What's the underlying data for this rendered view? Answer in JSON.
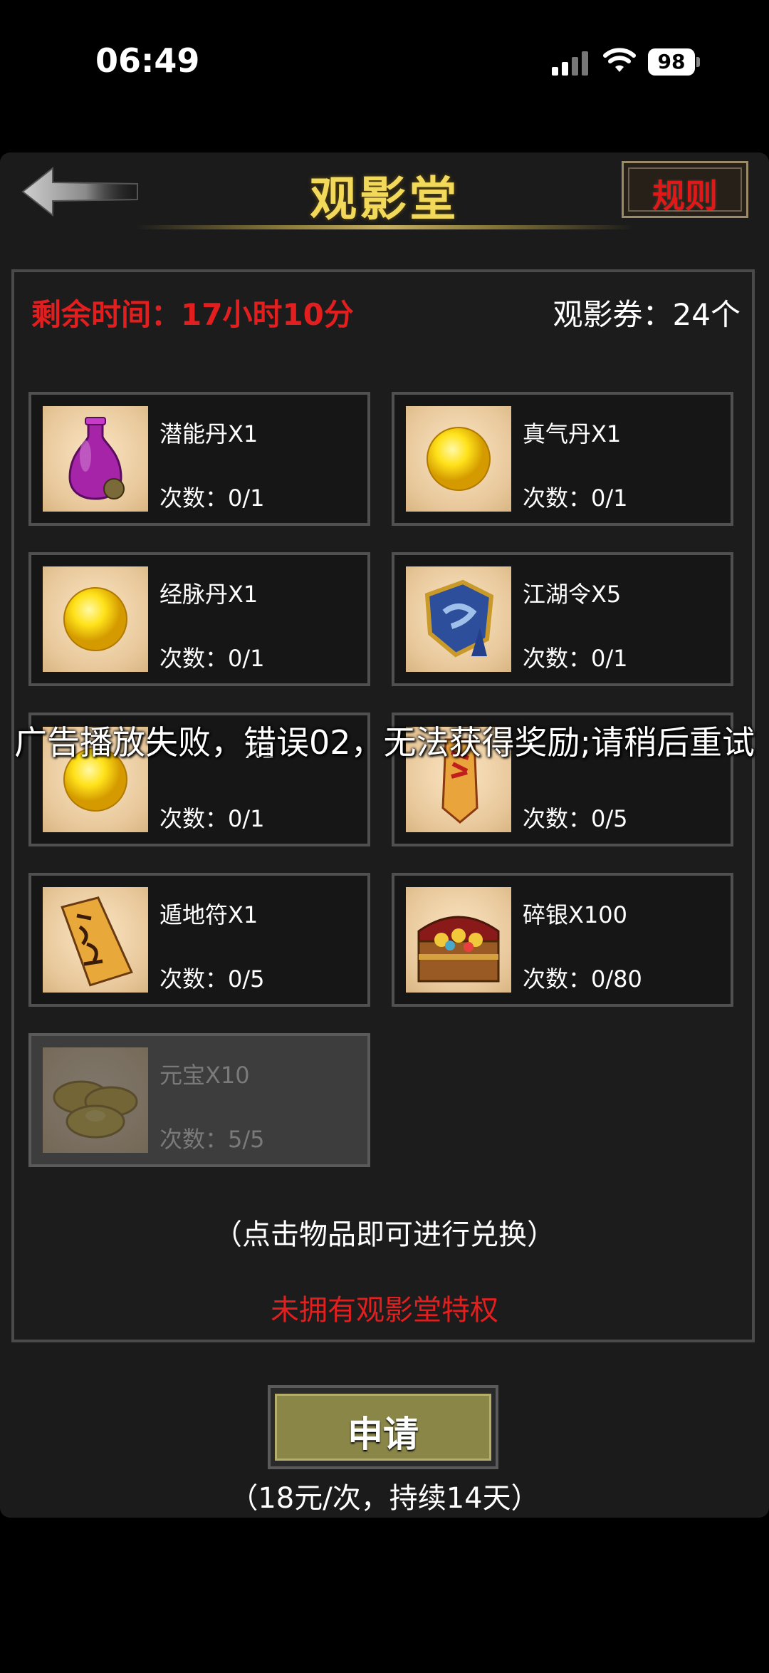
{
  "status_bar": {
    "time": "06:49",
    "battery": "98"
  },
  "header": {
    "title": "观影堂",
    "rules_label": "规则"
  },
  "summary": {
    "remaining_time": "剩余时间：17小时10分",
    "tickets": "观影券：24个"
  },
  "items": [
    {
      "name": "潜能丹X1",
      "count": "次数：0/1",
      "icon": "purple-vase-icon"
    },
    {
      "name": "真气丹X1",
      "count": "次数：0/1",
      "icon": "gold-pill-icon"
    },
    {
      "name": "经脉丹X1",
      "count": "次数：0/1",
      "icon": "gold-pill-icon"
    },
    {
      "name": "江湖令X5",
      "count": "次数：0/1",
      "icon": "jianghu-token-icon"
    },
    {
      "name": "X1",
      "count": "次数：0/1",
      "icon": "gold-pill-icon"
    },
    {
      "name": "",
      "count": "次数：0/5",
      "icon": "talisman-red-icon"
    },
    {
      "name": "遁地符X1",
      "count": "次数：0/5",
      "icon": "talisman-icon"
    },
    {
      "name": "碎银X100",
      "count": "次数：0/80",
      "icon": "treasure-chest-icon"
    },
    {
      "name": "元宝X10",
      "count": "次数：5/5",
      "icon": "gold-ingot-icon",
      "disabled": true
    }
  ],
  "hint": "（点击物品即可进行兑换）",
  "privilege_status": "未拥有观影堂特权",
  "apply": {
    "label": "申请",
    "price": "（18元/次，持续14天）"
  },
  "toast": "广告播放失败，错误02，无法获得奖励;请稍后重试",
  "colors": {
    "accent_gold": "#f2d95a",
    "alert_red": "#e31e1e",
    "button_olive": "#8a8648"
  }
}
